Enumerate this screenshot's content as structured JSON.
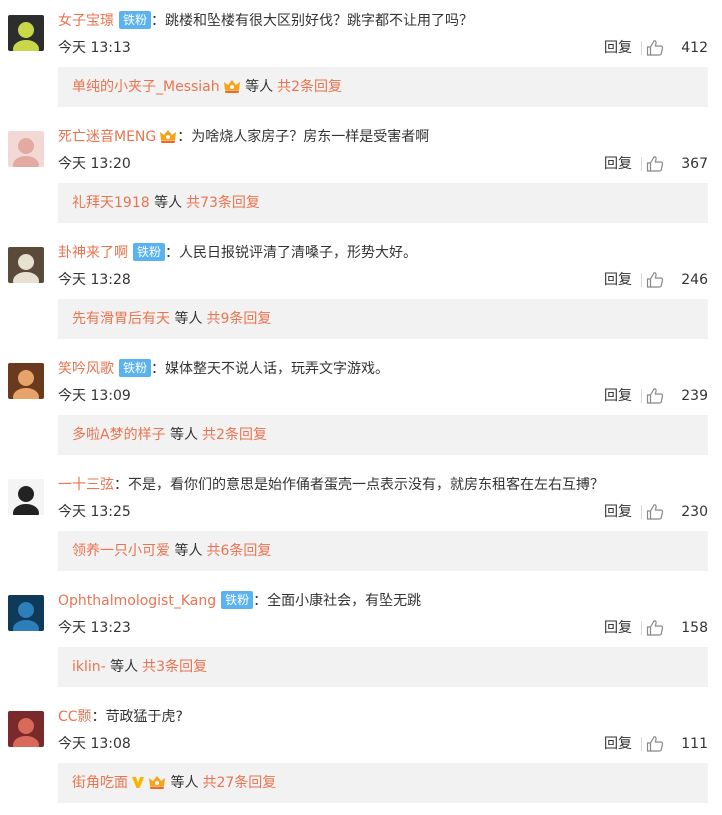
{
  "comments": [
    {
      "user": "女子宝璟",
      "fan_badge": "铁粉",
      "has_crown": false,
      "colon": "：",
      "text": "跳楼和坠楼有很大区别好伐？跳字都不让用了吗？",
      "time": "今天 13:13",
      "reply_label": "回复",
      "likes": "412",
      "more_user": "单纯的小夹子_Messiah",
      "more_user_crown": true,
      "more_user_v": false,
      "more_etc": "等人",
      "more_total": "共2条回复",
      "avatar": {
        "bg": "#2d2d2d",
        "fg": "#c9d84a"
      }
    },
    {
      "user": "死亡迷音MENG",
      "fan_badge": "",
      "has_crown": true,
      "colon": "：",
      "text": "为啥烧人家房子？房东一样是受害者啊",
      "time": "今天 13:20",
      "reply_label": "回复",
      "likes": "367",
      "more_user": "礼拜天1918",
      "more_user_crown": false,
      "more_user_v": false,
      "more_etc": "等人",
      "more_total": "共73条回复",
      "avatar": {
        "bg": "#f3d9d6",
        "fg": "#e3a9a3"
      }
    },
    {
      "user": "卦神来了啊",
      "fan_badge": "铁粉",
      "has_crown": false,
      "colon": "：",
      "text": "人民日报锐评清了清嗓子，形势大好。",
      "time": "今天 13:28",
      "reply_label": "回复",
      "likes": "246",
      "more_user": "先有滑胃后有天",
      "more_user_crown": false,
      "more_user_v": false,
      "more_etc": "等人",
      "more_total": "共9条回复",
      "avatar": {
        "bg": "#5a4a3a",
        "fg": "#e8e0d0"
      }
    },
    {
      "user": "笑吟风歌",
      "fan_badge": "铁粉",
      "has_crown": false,
      "colon": "：",
      "text": "媒体整天不说人话，玩弄文字游戏。",
      "time": "今天 13:09",
      "reply_label": "回复",
      "likes": "239",
      "more_user": "多啦A梦的样子",
      "more_user_crown": false,
      "more_user_v": false,
      "more_etc": "等人",
      "more_total": "共2条回复",
      "avatar": {
        "bg": "#6b3a1e",
        "fg": "#e6a46a"
      }
    },
    {
      "user": "一十三弦",
      "fan_badge": "",
      "has_crown": false,
      "colon": "：",
      "text": "不是，看你们的意思是始作俑者蛋壳一点表示没有，就房东租客在左右互搏？",
      "time": "今天 13:25",
      "reply_label": "回复",
      "likes": "230",
      "more_user": "领养一只小可爱",
      "more_user_crown": false,
      "more_user_v": false,
      "more_etc": "等人",
      "more_total": "共6条回复",
      "avatar": {
        "bg": "#f4f4f4",
        "fg": "#222222"
      }
    },
    {
      "user": "Ophthalmologist_Kang",
      "fan_badge": "铁粉",
      "has_crown": false,
      "colon": "：",
      "text": "全面小康社会，有坠无跳",
      "time": "今天 13:23",
      "reply_label": "回复",
      "likes": "158",
      "more_user": "iklin-",
      "more_user_crown": false,
      "more_user_v": false,
      "more_etc": "等人",
      "more_total": "共3条回复",
      "avatar": {
        "bg": "#0f3a5a",
        "fg": "#2c7fb8"
      }
    },
    {
      "user": "CC颢",
      "fan_badge": "",
      "has_crown": false,
      "colon": "：",
      "text": "苛政猛于虎?",
      "time": "今天 13:08",
      "reply_label": "回复",
      "likes": "111",
      "more_user": "街角吃面",
      "more_user_crown": true,
      "more_user_v": true,
      "more_etc": "等人",
      "more_total": "共27条回复",
      "avatar": {
        "bg": "#7a2a2a",
        "fg": "#d86a5a"
      }
    }
  ],
  "icons": {
    "like": "thumbs-up-icon",
    "crown": "member-crown-icon",
    "v": "gold-v-icon"
  },
  "colors": {
    "username": "#eb7350",
    "fan_badge": "#5ab3ee",
    "reply_box": "#f2f2f2"
  }
}
